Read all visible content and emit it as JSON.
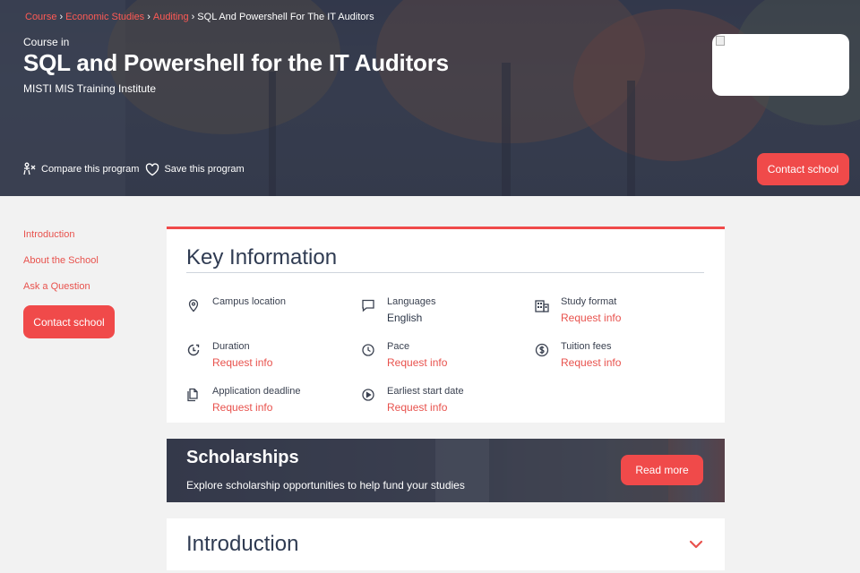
{
  "breadcrumb": {
    "items": [
      "Course",
      "Economic Studies",
      "Auditing"
    ],
    "current": "SQL And Powershell For The IT Auditors",
    "separator": "›"
  },
  "hero": {
    "eyebrow": "Course in",
    "title": "SQL and Powershell for the IT Auditors",
    "school": "MISTI MIS Training Institute",
    "compare_label": "Compare this program",
    "save_label": "Save this program",
    "contact_label": "Contact school"
  },
  "sidebar": {
    "links": [
      "Introduction",
      "About the School",
      "Ask a Question"
    ],
    "contact_label": "Contact school"
  },
  "key_info": {
    "title": "Key Information",
    "items": [
      {
        "label": "Campus location",
        "value": "",
        "icon": "location-pin-icon"
      },
      {
        "label": "Languages",
        "value": "English",
        "icon": "chat-bubble-icon"
      },
      {
        "label": "Study format",
        "value": "Request info",
        "icon": "building-icon"
      },
      {
        "label": "Duration",
        "value": "Request info",
        "icon": "duration-icon"
      },
      {
        "label": "Pace",
        "value": "Request info",
        "icon": "clock-icon"
      },
      {
        "label": "Tuition fees",
        "value": "Request info",
        "icon": "dollar-icon"
      },
      {
        "label": "Application deadline",
        "value": "Request info",
        "icon": "documents-icon"
      },
      {
        "label": "Earliest start date",
        "value": "Request info",
        "icon": "play-icon"
      }
    ]
  },
  "scholarships": {
    "title": "Scholarships",
    "subtitle": "Explore scholarship opportunities to help fund your studies",
    "button_label": "Read more"
  },
  "introduction": {
    "title": "Introduction"
  },
  "colors": {
    "accent": "#f04a4a",
    "link": "#e8524d",
    "heading": "#2f3b52"
  }
}
